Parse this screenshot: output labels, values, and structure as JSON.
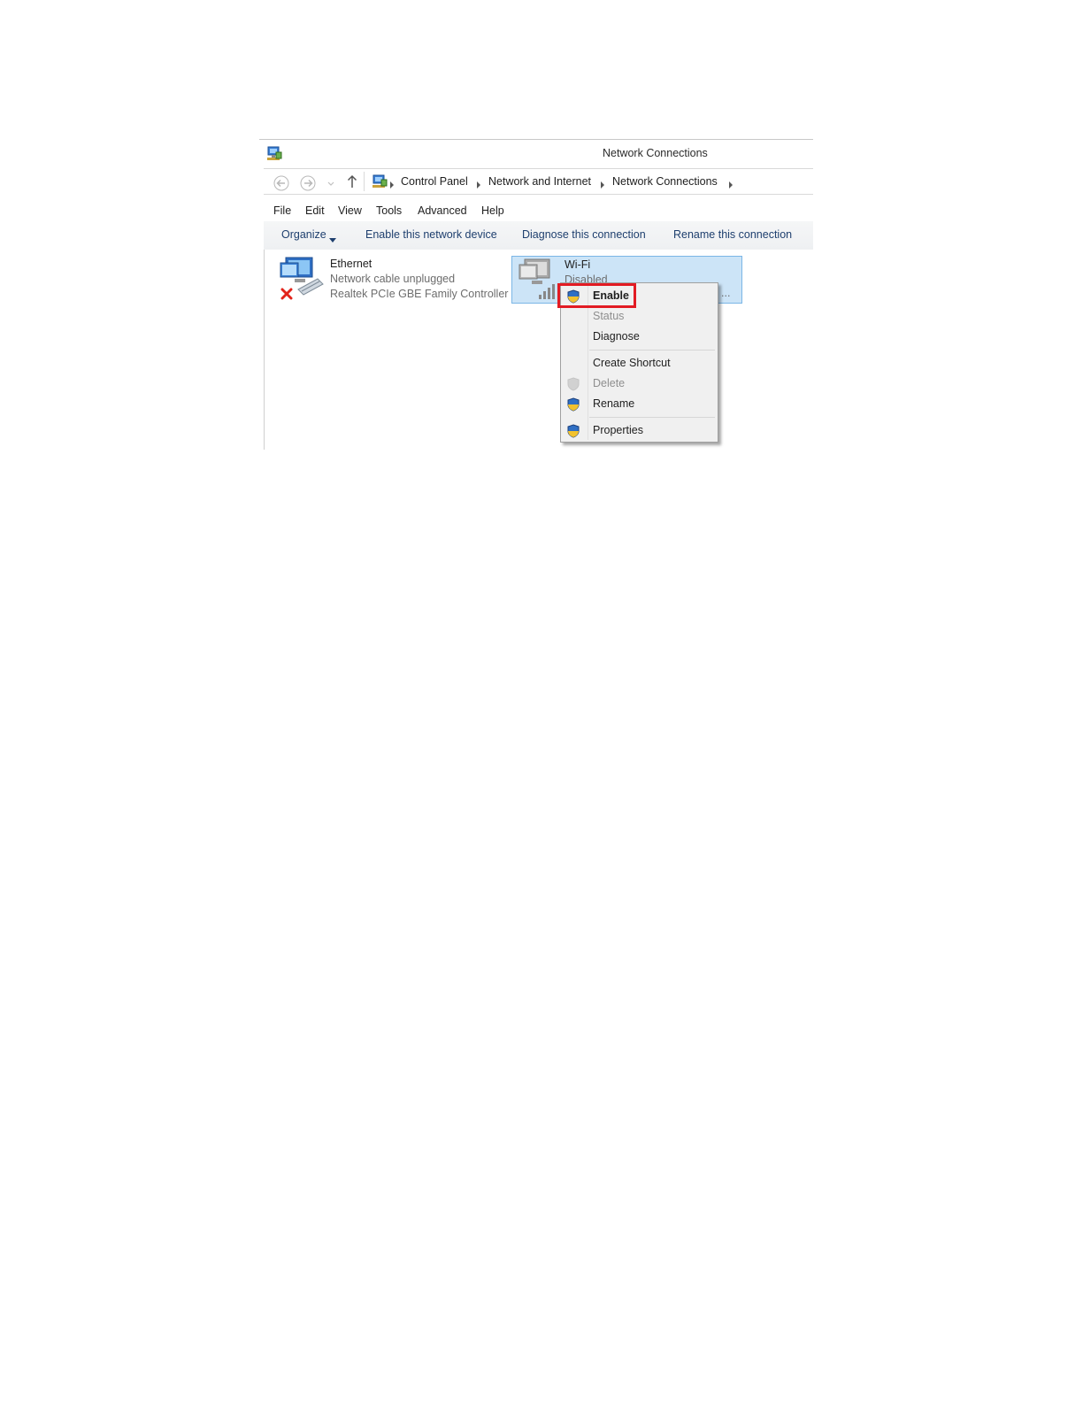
{
  "window": {
    "title": "Network Connections"
  },
  "address": {
    "crumbs": [
      "Control Panel",
      "Network and Internet",
      "Network Connections"
    ]
  },
  "menu": {
    "items": [
      "File",
      "Edit",
      "View",
      "Tools",
      "Advanced",
      "Help"
    ]
  },
  "toolbar": {
    "organize": "Organize",
    "enable": "Enable this network device",
    "diagnose": "Diagnose this connection",
    "rename": "Rename this connection"
  },
  "connections": [
    {
      "name": "Ethernet",
      "status": "Network cable unplugged",
      "device": "Realtek PCIe GBE Family Controller",
      "icon": "ethernet-adapter-icon"
    },
    {
      "name": "Wi-Fi",
      "status": "Disabled",
      "device": "...",
      "icon": "wifi-adapter-icon"
    }
  ],
  "context_menu": {
    "items": [
      {
        "label": "Enable",
        "icon": "uac-shield-icon",
        "bold": true
      },
      {
        "label": "Status",
        "disabled": true
      },
      {
        "label": "Diagnose"
      },
      {
        "label": "Create Shortcut"
      },
      {
        "label": "Delete",
        "icon": "uac-shield-icon",
        "disabled": true
      },
      {
        "label": "Rename",
        "icon": "uac-shield-icon"
      },
      {
        "label": "Properties",
        "icon": "uac-shield-icon"
      }
    ]
  },
  "colors": {
    "highlight": "#e21b23",
    "selection": "#cce4f7",
    "link": "#1e3f6e"
  }
}
